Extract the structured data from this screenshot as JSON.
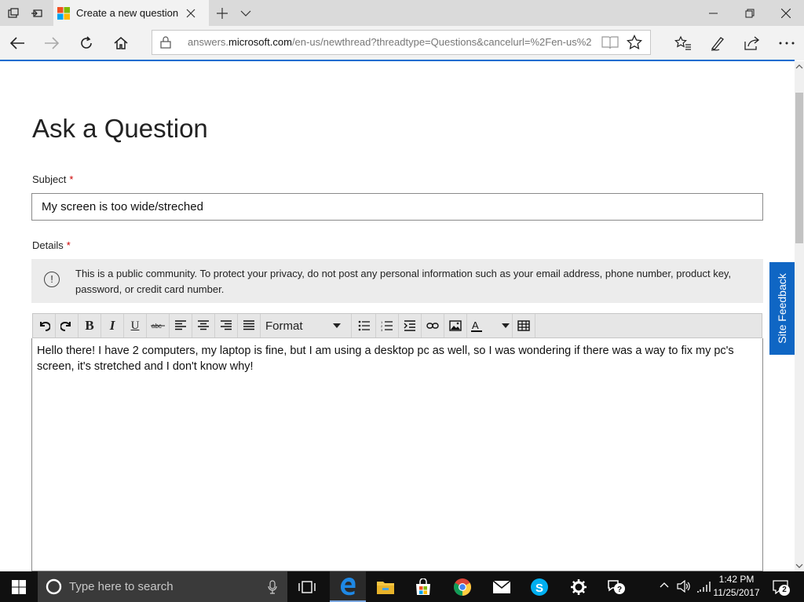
{
  "browser": {
    "tab_title": "Create a new question c",
    "url_prefix": "answers.",
    "url_domain": "microsoft.com",
    "url_rest": "/en-us/newthread?threadtype=Questions&cancelurl=%2Fen-us%2"
  },
  "page": {
    "title": "Ask a Question",
    "subject_label": "Subject",
    "required_mark": "*",
    "subject_value": "My screen is too wide/streched",
    "details_label": "Details",
    "notice": "This is a public community. To protect your privacy, do not post any personal information such as your email address, phone number, product key, password, or credit card number.",
    "format_label": "Format",
    "editor_text": "Hello there! I have 2 computers, my laptop is fine, but I  am using a desktop pc as well, so I was wondering if there was a way to fix my pc's screen, it's stretched and I don't know why!",
    "feedback_label": "Site Feedback"
  },
  "taskbar": {
    "search_placeholder": "Type here to search",
    "time": "1:42 PM",
    "date": "11/25/2017",
    "notification_count": "2"
  },
  "colors": {
    "accent": "#0a6cd0",
    "feedback": "#0f66c4",
    "required": "#cc0000"
  }
}
